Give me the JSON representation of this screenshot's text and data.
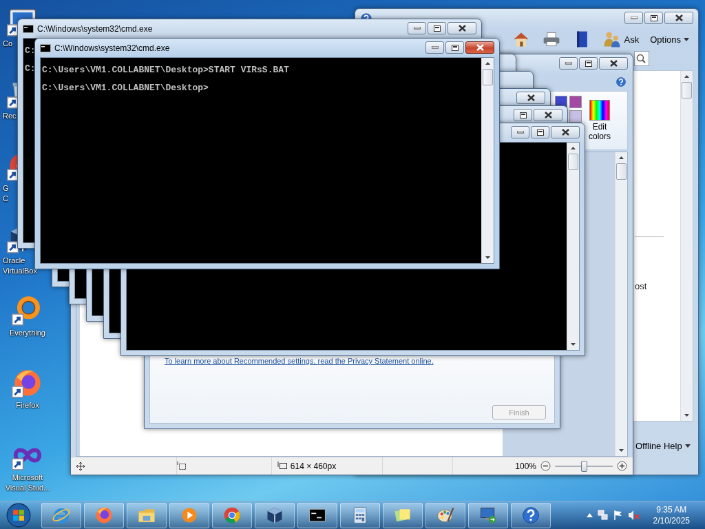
{
  "desktop_icons": [
    {
      "kind": "computer",
      "label": "Co"
    },
    {
      "kind": "recycle",
      "label": "Rec"
    },
    {
      "kind": "chrome",
      "label": "G\nC"
    },
    {
      "kind": "virtualbox",
      "label": "Oracle\nVirtualBox"
    },
    {
      "kind": "everything",
      "label": "Everything"
    },
    {
      "kind": "firefox",
      "label": "Firefox"
    },
    {
      "kind": "vstudio",
      "label": "Microsoft\nVisual Stud..."
    }
  ],
  "help_window": {
    "toolbar": [
      {
        "kind": "home"
      },
      {
        "kind": "printer"
      },
      {
        "kind": "book"
      }
    ],
    "ask_button": "Ask",
    "options_menu": "Options",
    "content_text": "ost",
    "footer_menu": "Offline Help"
  },
  "paint_window": {
    "color_swatches": [
      {
        "color": "#3f48cc"
      },
      {
        "color": "#a349a4"
      },
      {
        "color": "#c8bfe7"
      }
    ],
    "edit_colors": "Edit\ncolors",
    "status": {
      "image_size": "614 × 460px",
      "zoom": "100%",
      "zoom_slider": {
        "level": 0.5
      }
    }
  },
  "setup_dialog": {
    "link": "To learn more about Recommended settings, read the Privacy Statement online.",
    "finish_button": {
      "label": "Finish",
      "disabled": true
    }
  },
  "cmd_windows": [
    {
      "title": "C:\\Windows\\system32\\cmd.exe",
      "active": false,
      "lines": [
        "C:",
        "C:"
      ]
    },
    {
      "title": "C:\\Windows\\system32\\cmd.exe",
      "active": true,
      "lines": [
        "C:\\Users\\VM1.COLLABNET\\Desktop>START VIRsS.BAT",
        "C:\\Users\\VM1.COLLABNET\\Desktop>"
      ]
    }
  ],
  "taskbar": {
    "apps": [
      {
        "kind": "ie"
      },
      {
        "kind": "firefox"
      },
      {
        "kind": "explorer"
      },
      {
        "kind": "media"
      },
      {
        "kind": "chrome"
      },
      {
        "kind": "virtualbox"
      },
      {
        "kind": "cmd"
      },
      {
        "kind": "calc"
      },
      {
        "kind": "sticky"
      },
      {
        "kind": "paint"
      },
      {
        "kind": "remote"
      },
      {
        "kind": "help"
      }
    ],
    "clock": {
      "time": "9:35 AM",
      "date": "2/10/2025"
    }
  }
}
